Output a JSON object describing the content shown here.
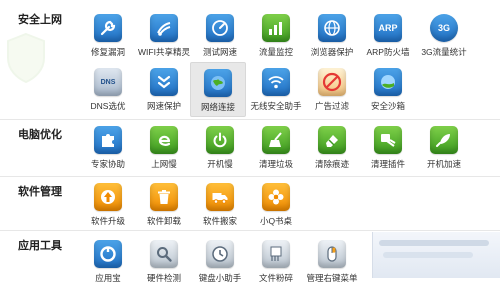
{
  "sections": {
    "security": "安全上网",
    "optimize": "电脑优化",
    "software": "软件管理",
    "apps": "应用工具"
  },
  "tiles": {
    "repair": "修复漏洞",
    "wifi": "WIFI共享精灵",
    "speed_test": "测试网速",
    "traffic": "流量监控",
    "browser_protect": "浏览器保护",
    "arp": "ARP防火墙",
    "g3_stats": "3G流量统计",
    "dns": "DNS选优",
    "net_protect": "网速保护",
    "net_connect": "网络连接",
    "wireless": "无线安全助手",
    "ad_filter": "广告过滤",
    "sandbox": "安全沙箱",
    "expert": "专家协助",
    "online": "上网慢",
    "boot_slow": "开机慢",
    "clean_junk": "清理垃圾",
    "clean_trace": "清除痕迹",
    "clean_plugin": "清理插件",
    "boot_speed": "开机加速",
    "upgrade": "软件升级",
    "uninstall": "软件卸载",
    "move": "软件搬家",
    "desk": "小Q书桌",
    "app_store": "应用宝",
    "hardware": "硬件检测",
    "keyboard": "键盘小助手",
    "shred": "文件粉碎",
    "context_menu": "管理右键菜单"
  },
  "icon_text": {
    "arp": "ARP",
    "g3": "3G",
    "dns": "DNS"
  },
  "colors": {
    "blue": "#2a7fd4",
    "green": "#4caf24",
    "orange": "#f7a11a",
    "gray": "#7b8794"
  }
}
